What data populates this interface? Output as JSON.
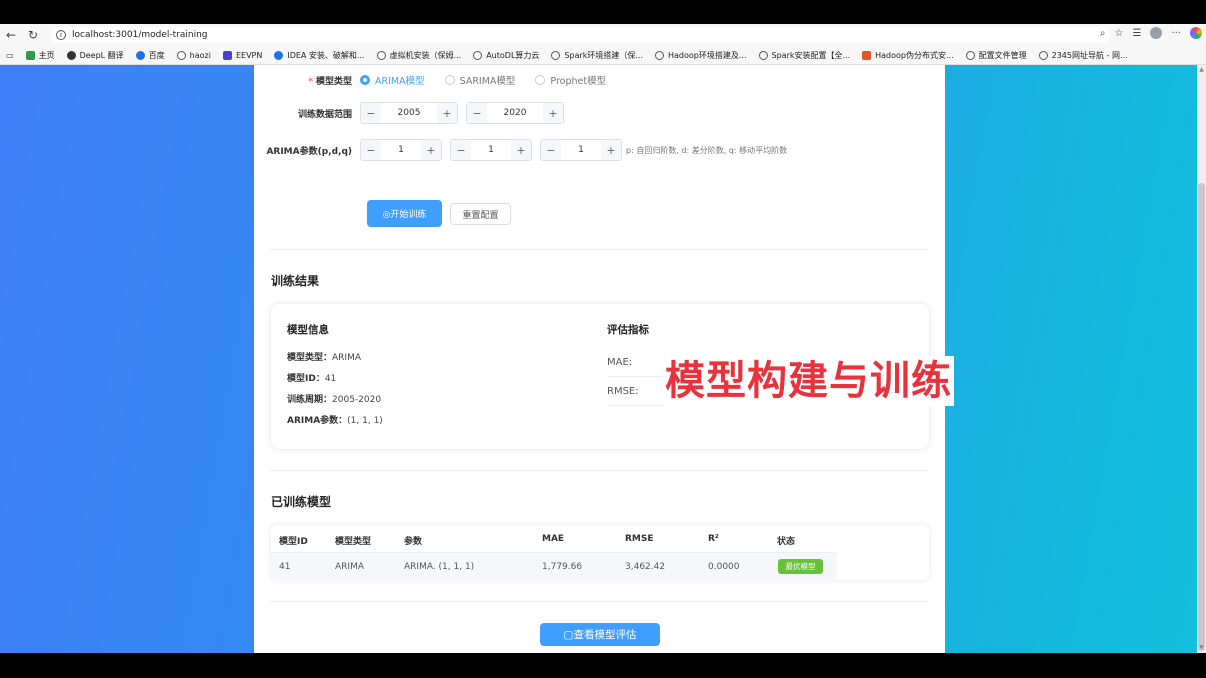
{
  "browser": {
    "url": "localhost:3001/model-training",
    "bookmarks": [
      "主页",
      "DeepL 翻译",
      "百度",
      "haozi",
      "EEVPN",
      "IDEA 安装、破解和...",
      "虚拟机安装（保姆...",
      "AutoDL算力云",
      "Spark环境搭建（保...",
      "Hadoop环境搭建及...",
      "Spark安装配置【全...",
      "Hadoop伪分布式安...",
      "配置文件管理",
      "2345网址导航 - 网..."
    ]
  },
  "form": {
    "model_type_label": "模型类型",
    "model_options": [
      "ARIMA模型",
      "SARIMA模型",
      "Prophet模型"
    ],
    "selected_model": "ARIMA模型",
    "range_label": "训练数据范围",
    "range_start": "2005",
    "range_end": "2020",
    "params_label": "ARIMA参数(p,d,q)",
    "p": "1",
    "d": "1",
    "q": "1",
    "params_hint": "p: 自回归阶数, d: 差分阶数, q: 移动平均阶数",
    "start_button": "◎开始训练",
    "reset_button": "重置配置"
  },
  "results": {
    "title": "训练结果",
    "model_info_title": "模型信息",
    "metrics_title": "评估指标",
    "info": [
      {
        "label": "模型类型：",
        "value": "ARIMA"
      },
      {
        "label": "模型ID：",
        "value": "41"
      },
      {
        "label": "训练周期：",
        "value": "2005-2020"
      },
      {
        "label": "ARIMA参数：",
        "value": "(1, 1, 1)"
      }
    ],
    "metrics": [
      {
        "label": "MAE:"
      },
      {
        "label": "RMSE:"
      }
    ]
  },
  "overlay": "模型构建与训练",
  "trained": {
    "title": "已训练模型",
    "columns": [
      "模型ID",
      "模型类型",
      "参数",
      "MAE",
      "RMSE",
      "R²",
      "状态"
    ],
    "rows": [
      {
        "id": "41",
        "type": "ARIMA",
        "params": "ARIMA. (1, 1, 1)",
        "mae": "1,779.66",
        "rmse": "3,462.42",
        "r2": "0.0000",
        "status": "最优模型"
      }
    ]
  },
  "eval_button": "▢查看模型评估",
  "colors": {
    "primary": "#409eff",
    "success": "#67c23a",
    "overlay": "#e8323c"
  }
}
